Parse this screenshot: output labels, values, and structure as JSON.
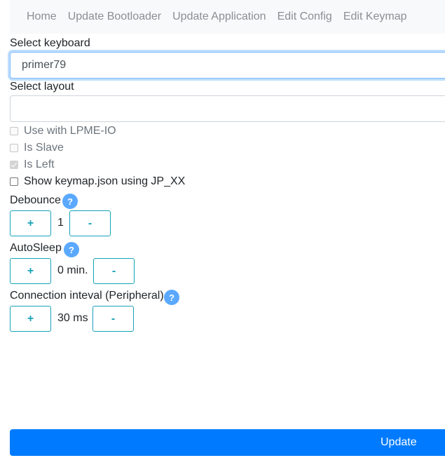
{
  "nav": {
    "items": [
      "Home",
      "Update Bootloader",
      "Update Application",
      "Edit Config",
      "Edit Keymap"
    ]
  },
  "keyboard": {
    "label": "Select keyboard",
    "value": "primer79"
  },
  "layout": {
    "label": "Select layout",
    "value": ""
  },
  "options": [
    {
      "label": "Use with LPME-IO",
      "checked": false,
      "disabled": true
    },
    {
      "label": "Is Slave",
      "checked": false,
      "disabled": true
    },
    {
      "label": "Is Left",
      "checked": true,
      "disabled": true
    },
    {
      "label": "Show keymap.json using JP_XX",
      "checked": false,
      "disabled": false
    }
  ],
  "debounce": {
    "label": "Debounce",
    "help": "?",
    "plus": "+",
    "value": "1",
    "minus": "-"
  },
  "autosleep": {
    "label": "AutoSleep",
    "help": "?",
    "plus": "+",
    "value": "0 min.",
    "minus": "-"
  },
  "interval": {
    "label": "Connection inteval (Peripheral)",
    "help": "?",
    "plus": "+",
    "value": "30 ms",
    "minus": "-"
  },
  "update_button": "Update",
  "colors": {
    "primary": "#007bff",
    "info": "#17a2b8",
    "help": "#5aa9ff"
  }
}
